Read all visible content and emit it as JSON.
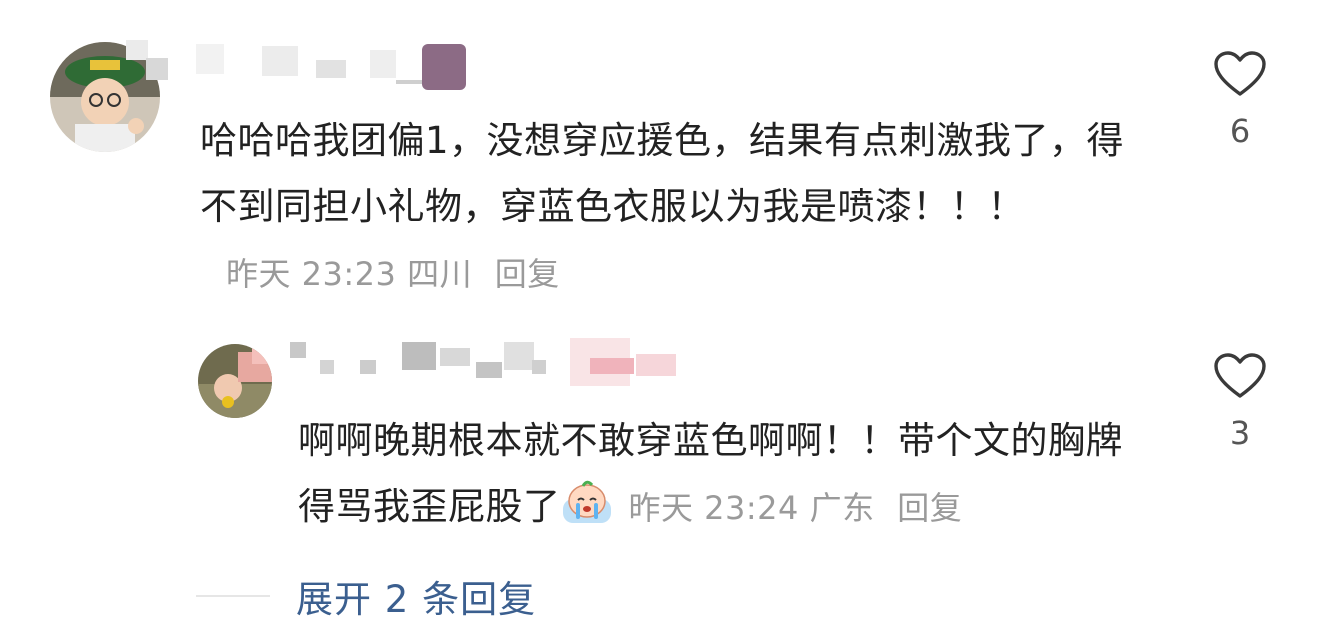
{
  "comments": [
    {
      "text": "哈哈哈我团偏1，没想穿应援色，结果有点刺激我了，得不到同担小礼物，穿蓝色衣服以为我是喷漆！！！",
      "time": "昨天 23:23",
      "location": "四川",
      "reply_label": "回复",
      "like_count": "6"
    },
    {
      "text": "啊啊晚期根本就不敢穿蓝色啊啊！！带个文的胸牌得骂我歪屁股了",
      "emoji": "crying-face-emoji",
      "time": "昨天 23:24",
      "location": "广东",
      "reply_label": "回复",
      "like_count": "3"
    }
  ],
  "expand_replies": "展开 2 条回复",
  "icons": {
    "like": "heart-outline-icon"
  },
  "colors": {
    "text": "#222222",
    "meta": "#9a9a9a",
    "link": "#3b5f8f"
  }
}
